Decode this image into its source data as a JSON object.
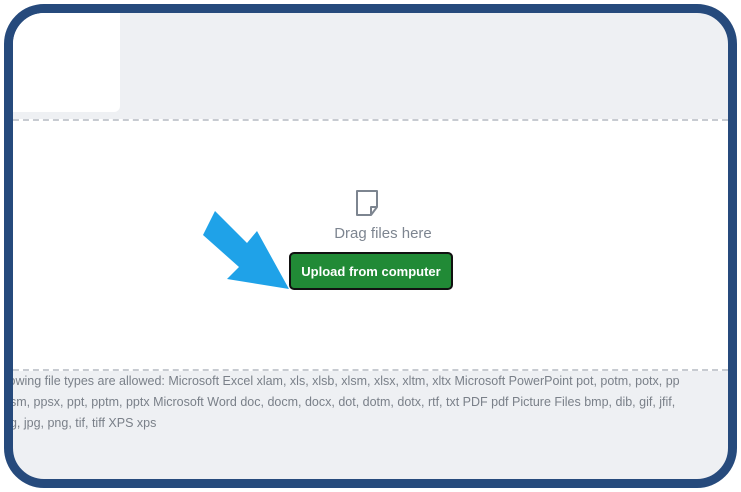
{
  "dropzone": {
    "drag_text": "Drag files here",
    "upload_label": "Upload from computer",
    "icon": "file-icon"
  },
  "colors": {
    "frame": "#264a7c",
    "button": "#218a36",
    "arrow": "#1fa2e8"
  },
  "allowed_types": {
    "lines": [
      "llowing file types are allowed: Microsoft Excel xlam, xls, xlsb, xlsm, xlsx, xltm, xltx Microsoft PowerPoint pot, potm, potx, pp",
      "psm, ppsx, ppt, pptm, pptx Microsoft Word doc, docm, docx, dot, dotm, dotx, rtf, txt PDF pdf Picture Files bmp, dib, gif, jfif,",
      "eg, jpg, png, tif, tiff XPS xps"
    ]
  }
}
